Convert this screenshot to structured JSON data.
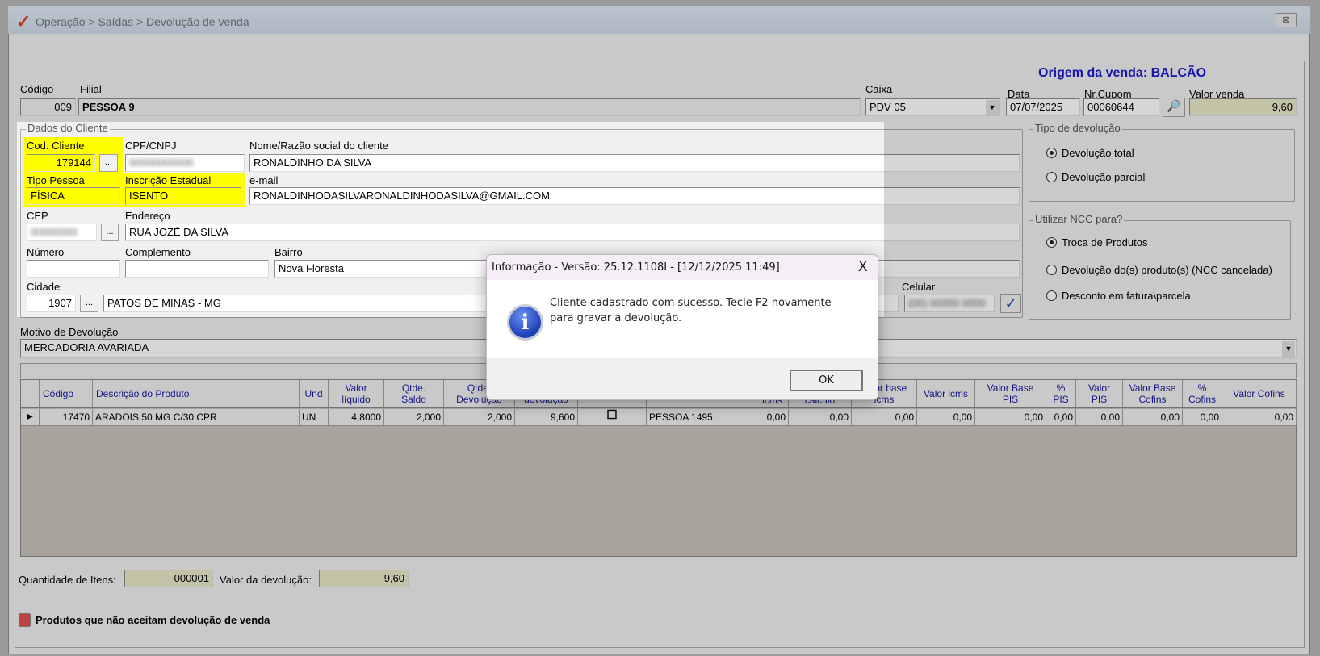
{
  "window": {
    "title": "Operação > Saídas > Devolução de venda",
    "close": "⊠"
  },
  "header": {
    "origem": "Origem da venda: BALCÃO",
    "codigo_label": "Código",
    "codigo": "009",
    "filial_label": "Filial",
    "filial": "PESSOA 9",
    "caixa_label": "Caixa",
    "caixa": "PDV 05",
    "data_label": "Data",
    "data": "07/07/2025",
    "cupom_label": "Nr.Cupom",
    "cupom": "00060644",
    "valor_venda_label": "Valor venda",
    "valor_venda": "9,60"
  },
  "cliente": {
    "group": "Dados do Cliente",
    "cod_label": "Cod. Cliente",
    "cod": "179144",
    "ellipsis": "...",
    "cpf_label": "CPF/CNPJ",
    "cpf": "00000000000",
    "nome_label": "Nome/Razão social do cliente",
    "nome": "RONALDINHO DA SILVA",
    "tipo_label": "Tipo Pessoa",
    "tipo": "FÍSICA",
    "ie_label": "Inscrição Estadual",
    "ie": "ISENTO",
    "email_label": "e-mail",
    "email": "RONALDINHODASILVARONALDINHODASILVA@GMAIL.COM",
    "cep_label": "CEP",
    "cep": "00000000",
    "endereco_label": "Endereço",
    "endereco": "RUA JOZÉ DA SILVA",
    "numero_label": "Número",
    "numero": "",
    "complemento_label": "Complemento",
    "complemento": "",
    "bairro_label": "Bairro",
    "bairro": "Nova Floresta",
    "cidade_label": "Cidade",
    "cidade_cod": "1907",
    "cidade": "PATOS DE MINAS - MG",
    "celular_label": "Celular",
    "celular": "(00) 00000 0000"
  },
  "tipo_devolucao": {
    "title": "Tipo de devolução",
    "options": [
      "Devolução total",
      "Devolução parcial"
    ],
    "selected": 0
  },
  "ncc": {
    "title": "Utilizar NCC para?",
    "options": [
      "Troca de Produtos",
      "Devolução do(s) produto(s) (NCC cancelada)",
      "Desconto em fatura\\parcela"
    ],
    "selected": 0
  },
  "motivo": {
    "label": "Motivo de Devolução",
    "value": "MERCADORIA AVARIADA"
  },
  "grid": {
    "headers": [
      "",
      "Código",
      "Descrição do Produto",
      "Und",
      "Valor\nlíquido",
      "Qtde.\nSaldo",
      "Qtde.\nDevolução",
      "Valor\ndevolução",
      "",
      "",
      "icms",
      "cálculo",
      "Valor base\nicms",
      "Valor icms",
      "Valor Base\nPIS",
      "%\nPIS",
      "Valor\nPIS",
      "Valor Base\nCofins",
      "%\nCofins",
      "Valor Cofins"
    ],
    "rows": [
      [
        "▶",
        "17470",
        "ARADOIS 50 MG C/30 CPR",
        "UN",
        "4,8000",
        "2,000",
        "2,000",
        "9,600",
        "☐",
        "PESSOA 1495",
        "0,00",
        "0,00",
        "0,00",
        "0,00",
        "0,00",
        "0,00",
        "0,00",
        "0,00",
        "0,00",
        "0,00"
      ]
    ]
  },
  "footer": {
    "qtd_label": "Quantidade de Itens:",
    "qtd": "000001",
    "valor_label": "Valor da devolução:",
    "valor": "9,60",
    "legend": "Produtos que não aceitam devolução de venda",
    "legend_color": "#e05050"
  },
  "dialog": {
    "title": "Informação - Versão: 25.12.1108I - [12/12/2025 11:49]",
    "message": "Cliente cadastrado com sucesso. Tecle F2 novamente para gravar a devolução.",
    "ok": "OK",
    "close": "X"
  }
}
